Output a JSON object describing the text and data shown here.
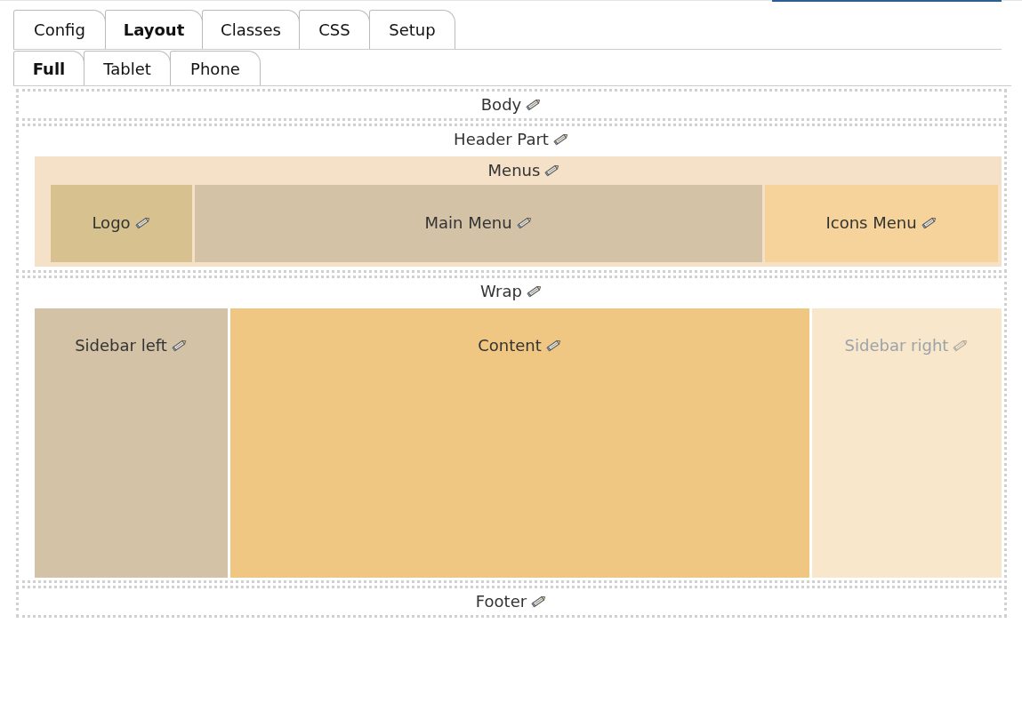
{
  "tabs": [
    {
      "label": "Config",
      "selected": false
    },
    {
      "label": "Layout",
      "selected": true
    },
    {
      "label": "Classes",
      "selected": false
    },
    {
      "label": "CSS",
      "selected": false
    },
    {
      "label": "Setup",
      "selected": false
    }
  ],
  "subtabs": [
    {
      "label": "Full",
      "selected": true
    },
    {
      "label": "Tablet",
      "selected": false
    },
    {
      "label": "Phone",
      "selected": false
    }
  ],
  "body": {
    "label": "Body"
  },
  "header": {
    "label": "Header Part",
    "menus": {
      "label": "Menus",
      "color": "#f4e1c7",
      "items": [
        {
          "label": "Logo",
          "color": "#d6c18f"
        },
        {
          "label": "Main Menu",
          "color": "#d4c2a6"
        },
        {
          "label": "Icons Menu",
          "color": "#f6d39a"
        }
      ]
    }
  },
  "wrap": {
    "label": "Wrap",
    "columns": [
      {
        "label": "Sidebar left",
        "color": "#d4c2a6",
        "disabled": false
      },
      {
        "label": "Content",
        "color": "#f0c683",
        "disabled": false
      },
      {
        "label": "Sidebar right",
        "color": "#f9e7cc",
        "disabled": true
      }
    ]
  },
  "footer": {
    "label": "Footer"
  }
}
